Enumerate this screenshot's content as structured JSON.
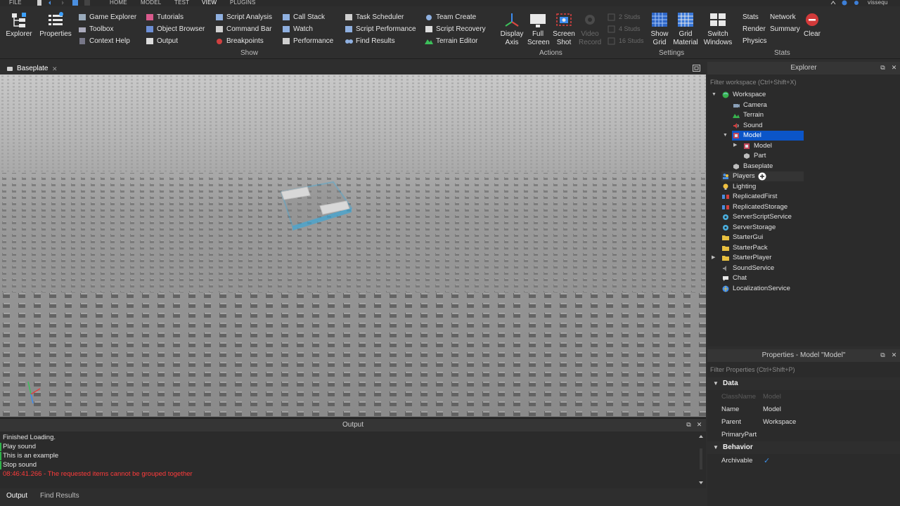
{
  "menubar": {
    "file": "FILE",
    "tabs": [
      "HOME",
      "MODEL",
      "TEST",
      "VIEW",
      "PLUGINS"
    ],
    "active_tab": "VIEW",
    "user": "vissequ"
  },
  "ribbon": {
    "show_group": {
      "label": "Show",
      "explorer": "Explorer",
      "properties": "Properties",
      "col1": [
        "Game Explorer",
        "Toolbox",
        "Context Help"
      ],
      "col2": [
        "Tutorials",
        "Object Browser",
        "Output"
      ],
      "col3": [
        "Script Analysis",
        "Command Bar",
        "Breakpoints"
      ],
      "col4": [
        "Call Stack",
        "Watch",
        "Performance"
      ],
      "col5": [
        "Task Scheduler",
        "Script Performance",
        "Find Results"
      ],
      "col6": [
        "Team Create",
        "Script Recovery",
        "Terrain Editor"
      ]
    },
    "actions_group": {
      "label": "Actions",
      "display_axis": [
        "Display",
        "Axis"
      ],
      "full_screen": [
        "Full",
        "Screen"
      ],
      "screen_shot": [
        "Screen",
        "Shot"
      ],
      "video_record": [
        "Video",
        "Record"
      ]
    },
    "settings_group": {
      "label": "Settings",
      "studs": [
        "2 Studs",
        "4 Studs",
        "16 Studs"
      ],
      "show_grid": [
        "Show",
        "Grid"
      ],
      "grid_material": [
        "Grid",
        "Material"
      ],
      "switch_windows": [
        "Switch",
        "Windows"
      ]
    },
    "stats_group": {
      "label": "Stats",
      "col1": [
        "Stats",
        "Render",
        "Physics"
      ],
      "col2": [
        "Network",
        "Summary"
      ],
      "clear": "Clear"
    }
  },
  "doc_tab": {
    "label": "Baseplate"
  },
  "output": {
    "title": "Output",
    "lines": [
      {
        "text": "Finished Loading.",
        "type": "info"
      },
      {
        "text": "Play sound",
        "type": "info"
      },
      {
        "text": "This is an example",
        "type": "info"
      },
      {
        "text": "Stop sound",
        "type": "info"
      },
      {
        "text": "08:46:41.266 - The requested items cannot be grouped together",
        "type": "error"
      }
    ],
    "bottom_tabs": [
      "Output",
      "Find Results"
    ]
  },
  "explorer": {
    "title": "Explorer",
    "filter_placeholder": "Filter workspace (Ctrl+Shift+X)",
    "items": [
      {
        "label": "Workspace",
        "icon": "workspace-icon"
      },
      {
        "label": "Camera",
        "icon": "camera-icon"
      },
      {
        "label": "Terrain",
        "icon": "terrain-icon"
      },
      {
        "label": "Sound",
        "icon": "sound-icon"
      },
      {
        "label": "Model",
        "icon": "model-icon",
        "selected": true
      },
      {
        "label": "Model",
        "icon": "model-icon"
      },
      {
        "label": "Part",
        "icon": "part-icon"
      },
      {
        "label": "Baseplate",
        "icon": "part-icon"
      },
      {
        "label": "Players",
        "icon": "players-icon"
      },
      {
        "label": "Lighting",
        "icon": "lighting-icon"
      },
      {
        "label": "ReplicatedFirst",
        "icon": "replicated-first-icon"
      },
      {
        "label": "ReplicatedStorage",
        "icon": "replicated-storage-icon"
      },
      {
        "label": "ServerScriptService",
        "icon": "server-script-service-icon"
      },
      {
        "label": "ServerStorage",
        "icon": "server-storage-icon"
      },
      {
        "label": "StarterGui",
        "icon": "starter-gui-icon"
      },
      {
        "label": "StarterPack",
        "icon": "starter-pack-icon"
      },
      {
        "label": "StarterPlayer",
        "icon": "starter-player-icon"
      },
      {
        "label": "SoundService",
        "icon": "sound-service-icon"
      },
      {
        "label": "Chat",
        "icon": "chat-icon"
      },
      {
        "label": "LocalizationService",
        "icon": "localization-service-icon"
      }
    ]
  },
  "properties": {
    "title": "Properties - Model \"Model\"",
    "filter_placeholder": "Filter Properties (Ctrl+Shift+P)",
    "sections": [
      {
        "name": "Data",
        "rows": [
          {
            "name": "ClassName",
            "value": "Model",
            "dim": true
          },
          {
            "name": "Name",
            "value": "Model"
          },
          {
            "name": "Parent",
            "value": "Workspace"
          },
          {
            "name": "PrimaryPart",
            "value": ""
          }
        ]
      },
      {
        "name": "Behavior",
        "rows": [
          {
            "name": "Archivable",
            "value": "✓"
          }
        ]
      }
    ]
  },
  "colors": {
    "accent_selection": "#0b55c8",
    "error_text": "#ff3b3b",
    "panel_bg": "#2b2b2b"
  }
}
